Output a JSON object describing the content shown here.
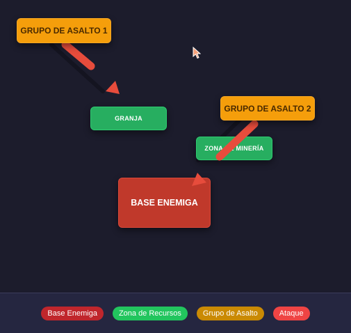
{
  "nodes": {
    "group1": "GRUPO DE ASALTO 1",
    "group2": "GRUPO DE ASALTO 2",
    "farm": "GRANJA",
    "mining": "ZONA DE MINERÍA",
    "enemy_base": "BASE ENEMIGA"
  },
  "legend": {
    "enemy_base": {
      "label": "Base Enemiga",
      "color": "#c0262c"
    },
    "resource_zone": {
      "label": "Zona de Recursos",
      "color": "#22c55e"
    },
    "assault_group": {
      "label": "Grupo de Asalto",
      "color": "#ca8a04"
    },
    "attack": {
      "label": "Ataque",
      "color": "#ef4444"
    }
  },
  "colors": {
    "background": "#1c1c2c",
    "assault": "#f59e0b",
    "resource": "#27ae60",
    "enemy": "#c0392b",
    "attack_arrow": "#e74c3c"
  },
  "icons": {
    "cursor": "pointer-cursor-icon",
    "arrow": "attack-arrow-icon"
  }
}
